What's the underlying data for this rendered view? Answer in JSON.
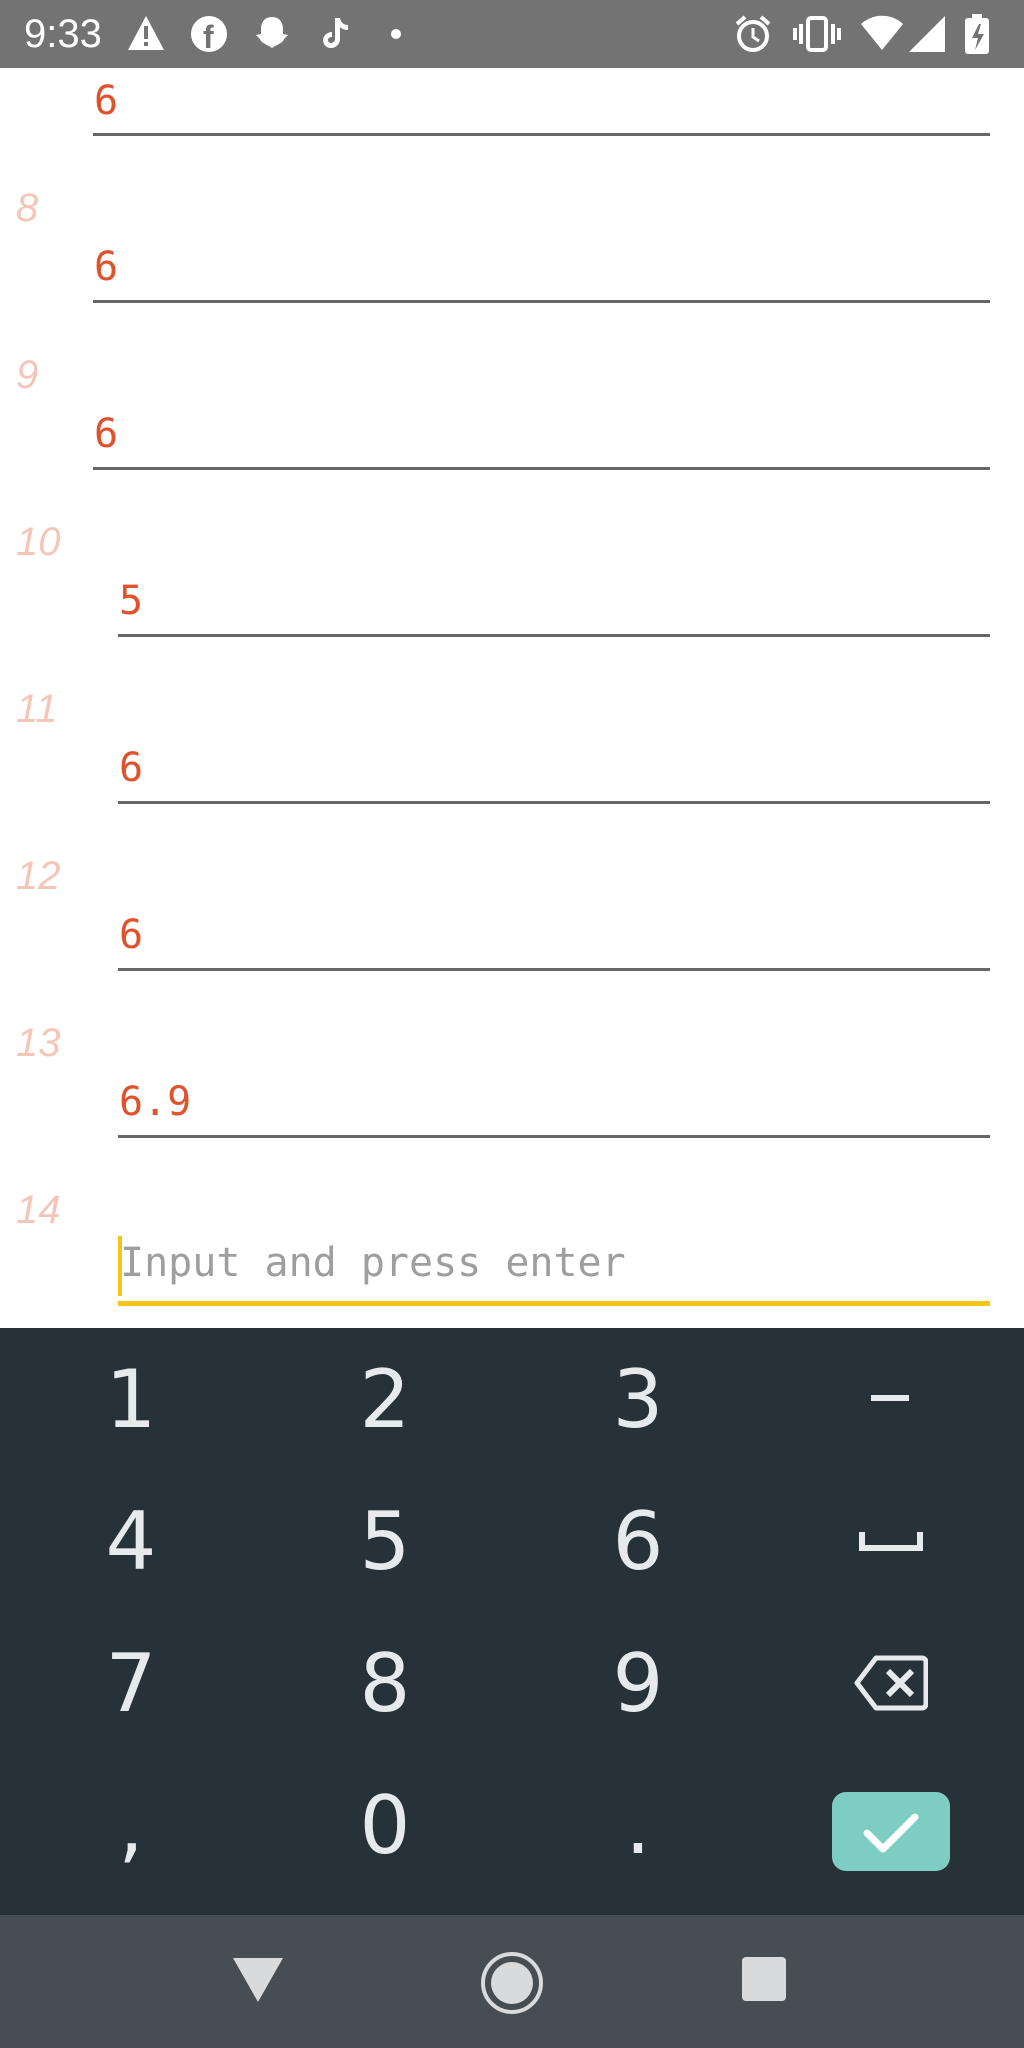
{
  "status_bar": {
    "time": "9:33",
    "icons": [
      "warning-icon",
      "facebook-icon",
      "snapchat-icon",
      "tiktok-icon",
      "dot-icon",
      "alarm-icon",
      "vibrate-icon",
      "wifi-icon",
      "signal-icon",
      "battery-charging-icon"
    ]
  },
  "rows": [
    {
      "index": "",
      "value": "6"
    },
    {
      "index": "8",
      "value": "6"
    },
    {
      "index": "9",
      "value": "6"
    },
    {
      "index": "10",
      "value": "5"
    },
    {
      "index": "11",
      "value": "6"
    },
    {
      "index": "12",
      "value": "6"
    },
    {
      "index": "13",
      "value": "6.9"
    }
  ],
  "input": {
    "index": "14",
    "placeholder": "Input and press enter"
  },
  "keypad": {
    "keys": [
      "1",
      "2",
      "3",
      "-",
      "4",
      "5",
      "6",
      "␣",
      "7",
      "8",
      "9",
      "⌫",
      ",",
      "0",
      ".",
      "✓"
    ]
  },
  "nav": {
    "icons": [
      "back-icon",
      "home-icon",
      "recents-icon"
    ]
  },
  "colors": {
    "accent": "#f5c518",
    "value": "#e0522b",
    "index": "#f3c6b8",
    "keypad_bg": "#263238",
    "confirm": "#7ecdc3"
  }
}
